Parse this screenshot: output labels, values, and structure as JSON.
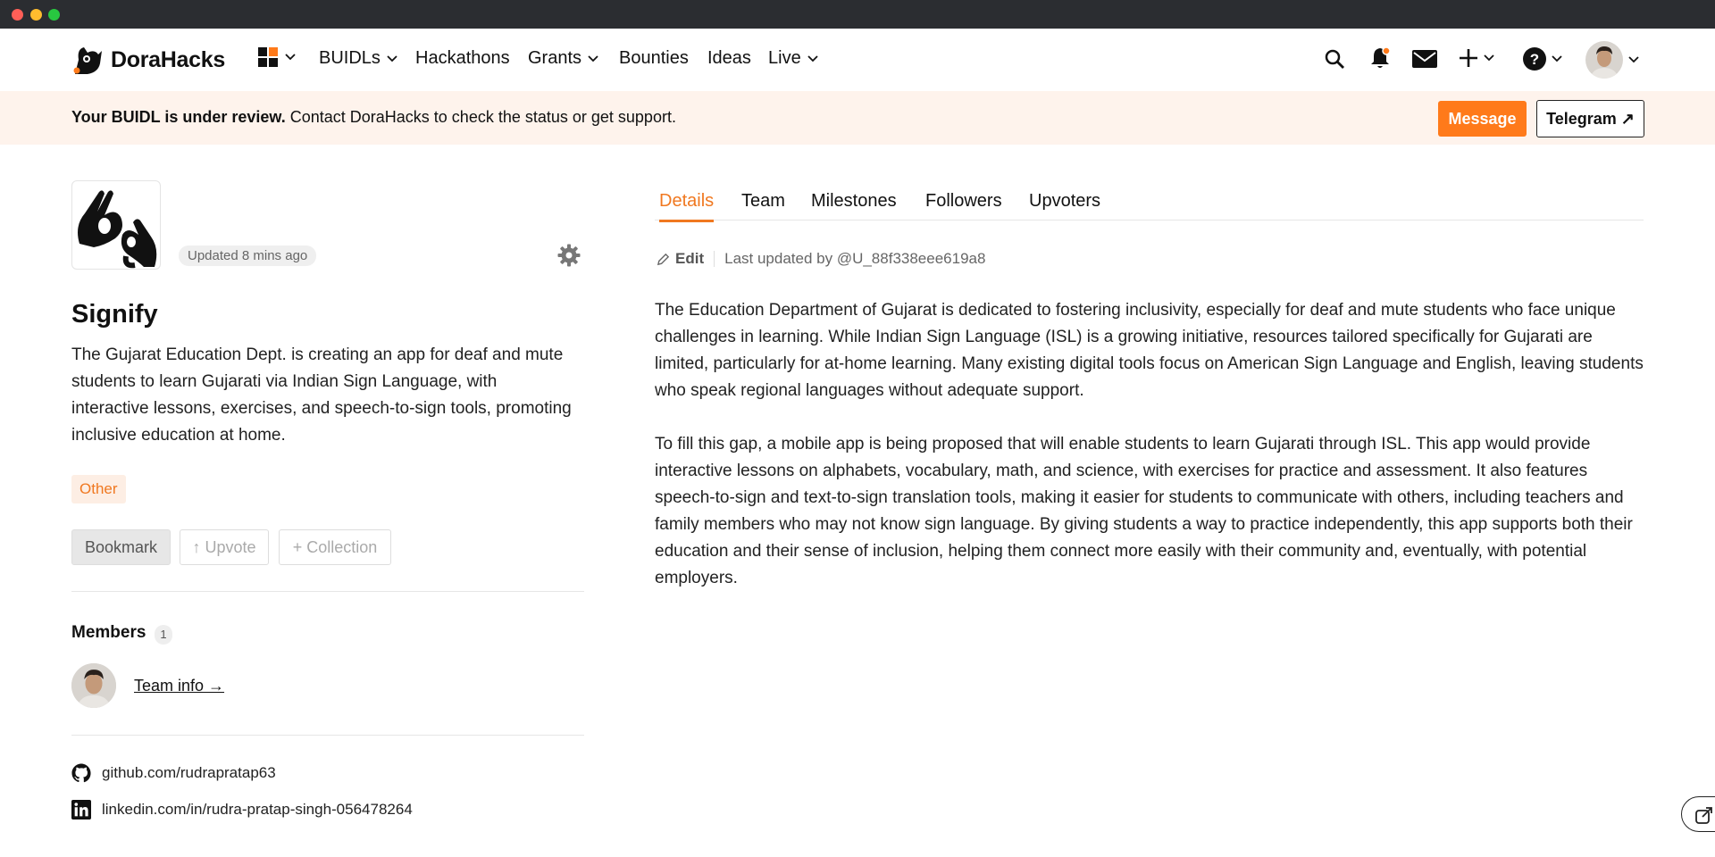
{
  "nav": {
    "brand": "DoraHacks",
    "items": [
      "BUIDLs",
      "Hackathons",
      "Grants",
      "Bounties",
      "Ideas",
      "Live"
    ]
  },
  "banner": {
    "bold": "Your BUIDL is under review.",
    "text": " Contact DoraHacks to check the status or get support.",
    "message_button": "Message",
    "telegram_button": "Telegram ↗"
  },
  "project": {
    "updated": "Updated 8 mins ago",
    "title": "Signify",
    "description": "The Gujarat Education Dept. is creating an app for deaf and mute students to learn Gujarati via Indian Sign Language, with interactive lessons, exercises, and speech-to-sign tools, promoting inclusive education at home.",
    "tag": "Other",
    "actions": {
      "bookmark": "Bookmark",
      "upvote": "↑ Upvote",
      "collection": "+ Collection"
    }
  },
  "members": {
    "label": "Members",
    "count": "1",
    "team_link": "Team info →"
  },
  "links": {
    "github": "github.com/rudrapratap63",
    "linkedin": "linkedin.com/in/rudra-pratap-singh-056478264"
  },
  "tabs": [
    "Details",
    "Team",
    "Milestones",
    "Followers",
    "Upvoters"
  ],
  "details": {
    "edit": "Edit",
    "last_updated": "Last updated by @U_88f338eee619a8",
    "paragraphs": [
      "The Education Department of Gujarat is dedicated to fostering inclusivity, especially for deaf and mute students who face unique challenges in learning. While Indian Sign Language (ISL) is a growing initiative, resources tailored specifically for Gujarati are limited, particularly for at-home learning. Many existing digital tools focus on American Sign Language and English, leaving students who speak regional languages without adequate support.",
      "To fill this gap, a mobile app is being proposed that will enable students to learn Gujarati through ISL. This app would provide interactive lessons on alphabets, vocabulary, math, and science, with exercises for practice and assessment. It also features speech-to-sign and text-to-sign translation tools, making it easier for students to communicate with others, including teachers and family members who may not know sign language. By giving students a way to practice independently, this app supports both their education and their sense of inclusion, helping them connect more easily with their community and, eventually, with potential employers."
    ]
  },
  "colors": {
    "accent": "#ff7a1a",
    "banner_bg": "#fef3ec",
    "tag_bg": "#fdeee4"
  },
  "icons": [
    "apps-grid-icon",
    "search-icon",
    "bell-icon",
    "mail-icon",
    "plus-icon",
    "help-icon",
    "gear-icon",
    "github-icon",
    "linkedin-icon",
    "pencil-icon",
    "share-icon"
  ]
}
